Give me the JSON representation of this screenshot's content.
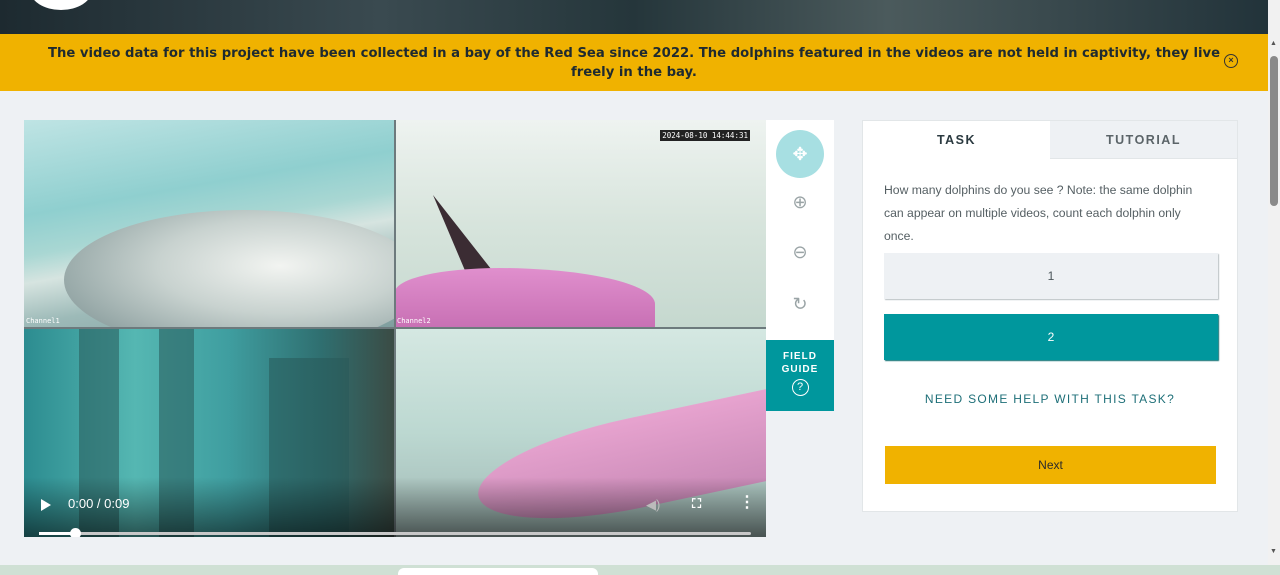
{
  "announcement": {
    "text": "The video data for this project have been collected in a bay of the Red Sea since 2022. The dolphins featured in the videos are not held in captivity, they live freely in the bay.",
    "close_icon": "×"
  },
  "viewer": {
    "cam1_label": "Channel1",
    "cam2_label": "Channel2",
    "timestamp": "2024-08-10 14:44:31",
    "time_display": "0:00 / 0:09",
    "progress": 0.05
  },
  "toolbar": {
    "move_icon": "✥",
    "zoom_in_icon": "⊕",
    "zoom_out_icon": "⊖",
    "rotate_icon": "↻"
  },
  "field_guide": {
    "label": "FIELD GUIDE",
    "icon": "?"
  },
  "task_panel": {
    "tabs": [
      {
        "label": "TASK"
      },
      {
        "label": "TUTORIAL"
      }
    ],
    "question": "How many dolphins do you see ? Note: the same dolphin can appear on multiple videos, count each dolphin only once.",
    "answers": [
      {
        "label": "1"
      },
      {
        "label": "2"
      }
    ],
    "help_link": "NEED SOME HELP WITH THIS TASK?",
    "next_label": "Next"
  },
  "colors": {
    "accent_teal": "#00979d",
    "banner_yellow": "#f0b200"
  }
}
